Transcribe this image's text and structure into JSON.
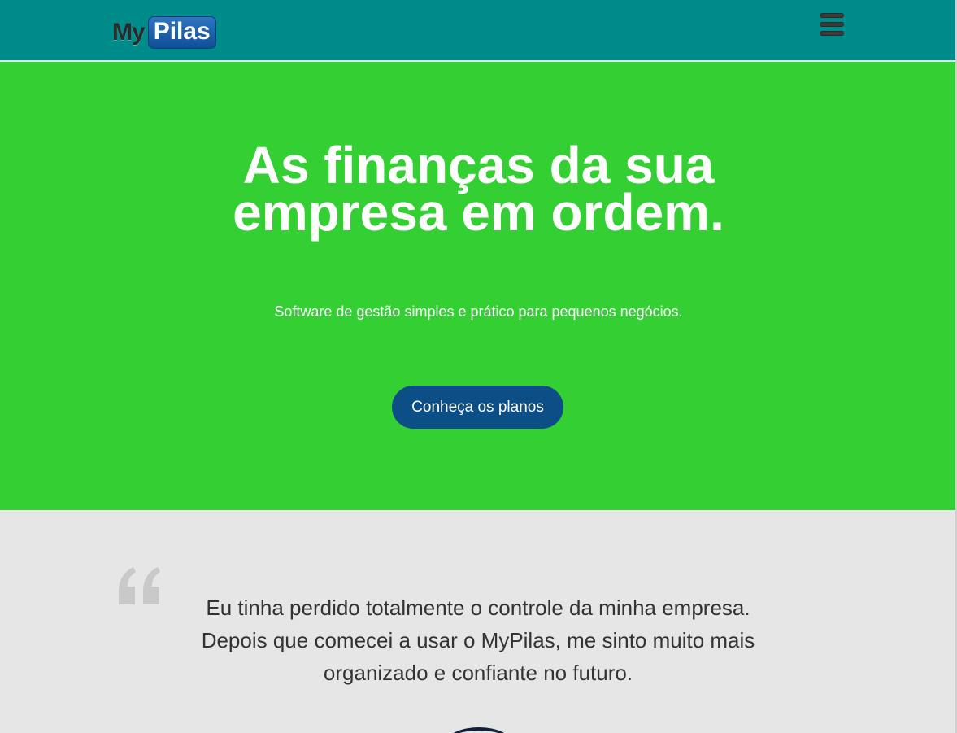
{
  "navbar": {
    "logo_part1": "My",
    "logo_part2": "Pilas",
    "menu_icon": "hamburger-menu-icon",
    "background": "#008b8b"
  },
  "hero": {
    "title_line1": "As finanças da sua",
    "title_line2": "empresa em ordem.",
    "subtitle": "Software de gestão simples e prático para pequenos negócios.",
    "cta_label": "Conheça os planos",
    "background": "#33cf33",
    "cta_color": "#0b4f86"
  },
  "testimonial": {
    "quote_icon": "quote-icon",
    "line1": "Eu tinha perdido totalmente o controle da minha empresa.",
    "line2": "Depois que comecei a usar o MyPilas, me sinto muito mais",
    "line3": "organizado e confiante no futuro.",
    "background": "#e6e6e6"
  }
}
